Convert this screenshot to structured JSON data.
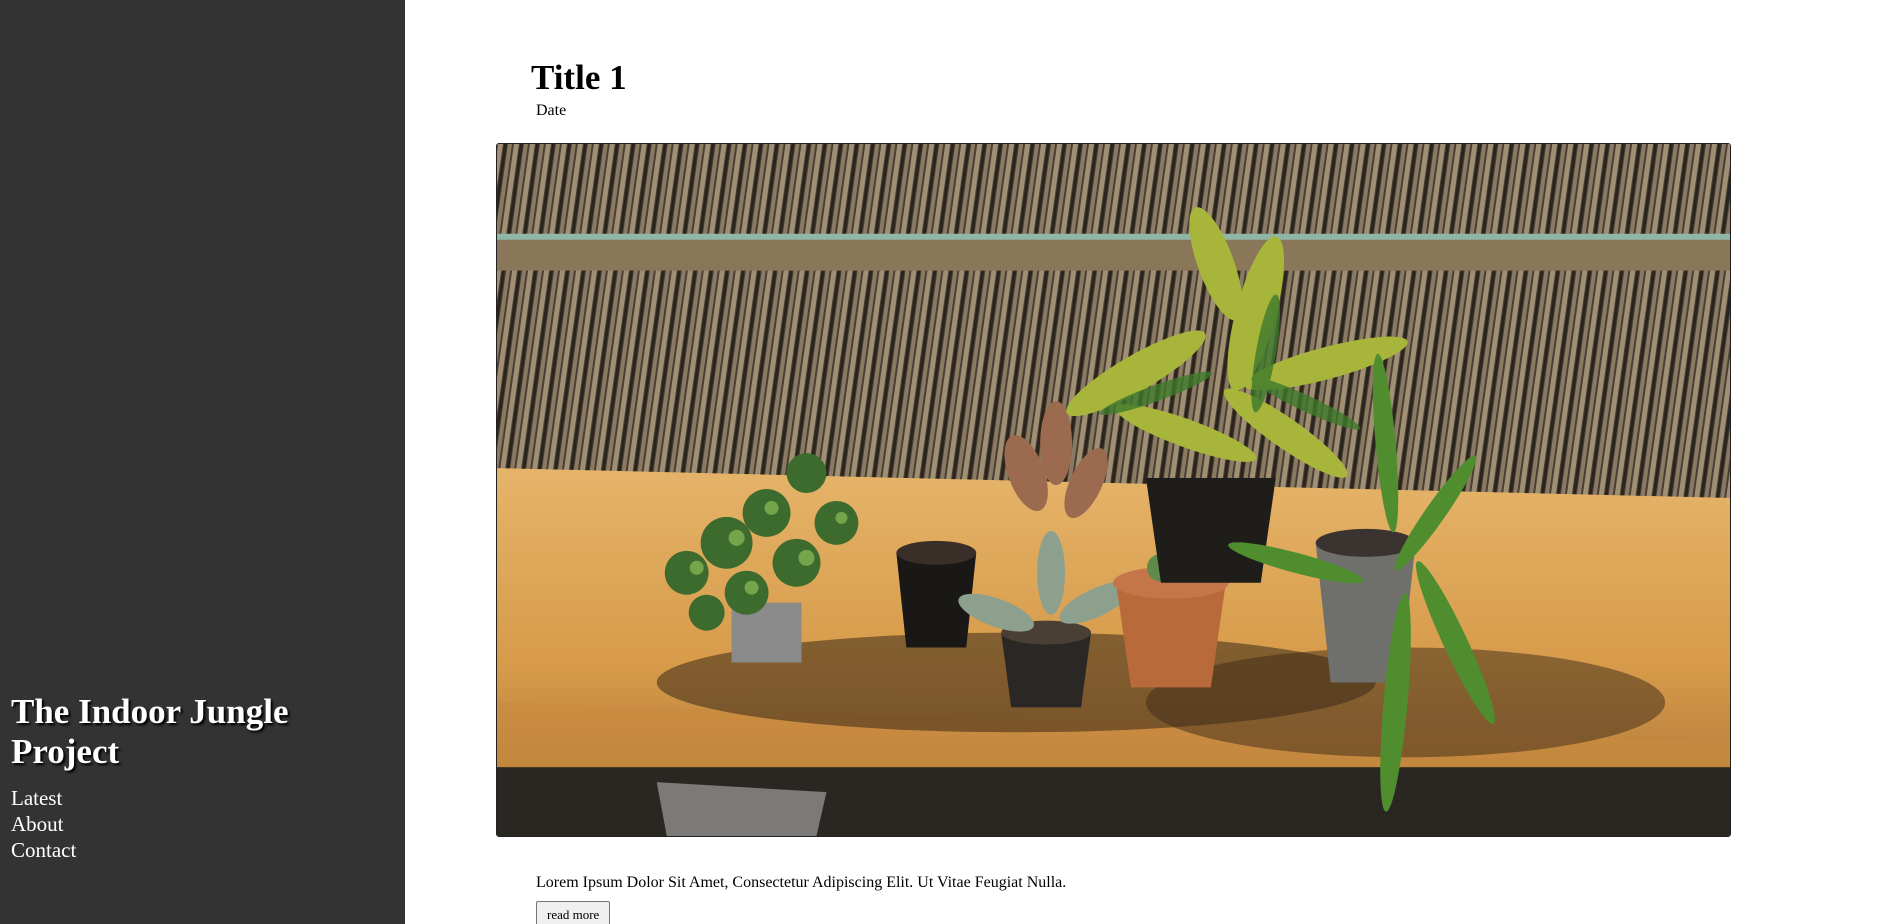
{
  "sidebar": {
    "site_title": "The Indoor Jungle Project",
    "nav": [
      "Latest",
      "About",
      "Contact"
    ]
  },
  "post": {
    "title": "Title 1",
    "date": "Date",
    "image_alt": "potted plants on a wooden bench",
    "excerpt": "Lorem Ipsum Dolor Sit Amet, Consectetur Adipiscing Elit. Ut Vitae Feugiat Nulla.",
    "read_more": "read more"
  }
}
